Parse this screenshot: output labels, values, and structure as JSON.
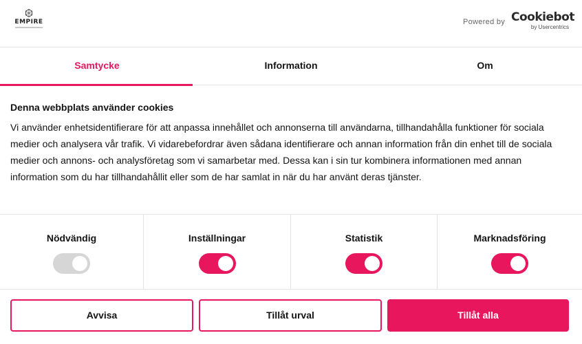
{
  "header": {
    "logo_name": "EMPIRE",
    "powered_by": "Powered by",
    "brand_name": "Cookiebot",
    "brand_sub": "by Usercentrics"
  },
  "tabs": [
    {
      "label": "Samtycke",
      "active": true
    },
    {
      "label": "Information",
      "active": false
    },
    {
      "label": "Om",
      "active": false
    }
  ],
  "content": {
    "heading": "Denna webbplats använder cookies",
    "body": "Vi använder enhetsidentifierare för att anpassa innehållet och annonserna till användarna, tillhandahålla funktioner för sociala medier och analysera vår trafik. Vi vidarebefordrar även sådana identifierare och annan information från din enhet till de sociala medier och annons- och analysföretag som vi samarbetar med. Dessa kan i sin tur kombinera informationen med annan information som du har tillhandahållit eller som de har samlat in när du har använt deras tjänster."
  },
  "toggles": [
    {
      "label": "Nödvändig",
      "on": true,
      "disabled": true
    },
    {
      "label": "Inställningar",
      "on": true,
      "disabled": false
    },
    {
      "label": "Statistik",
      "on": true,
      "disabled": false
    },
    {
      "label": "Marknadsföring",
      "on": true,
      "disabled": false
    }
  ],
  "buttons": {
    "reject": "Avvisa",
    "allow_selection": "Tillåt urval",
    "allow_all": "Tillåt alla"
  },
  "colors": {
    "accent": "#e8175d",
    "toggle_disabled": "#d6d6d6",
    "divider": "#e4e4e4"
  }
}
